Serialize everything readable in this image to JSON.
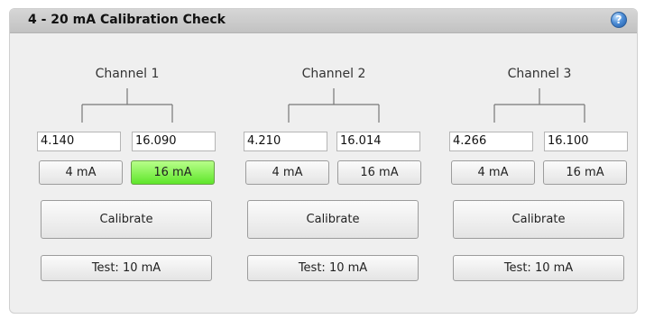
{
  "panel": {
    "title": "4 - 20 mA Calibration Check",
    "help_icon_glyph": "?"
  },
  "channels": [
    {
      "label": "Channel 1",
      "low_value": "4.140",
      "high_value": "16.090",
      "btn_4": "4 mA",
      "btn_16": "16 mA",
      "btn_16_active": true,
      "calibrate": "Calibrate",
      "test": "Test: 10 mA"
    },
    {
      "label": "Channel 2",
      "low_value": "4.210",
      "high_value": "16.014",
      "btn_4": "4 mA",
      "btn_16": "16 mA",
      "btn_16_active": false,
      "calibrate": "Calibrate",
      "test": "Test: 10 mA"
    },
    {
      "label": "Channel 3",
      "low_value": "4.266",
      "high_value": "16.100",
      "btn_4": "4 mA",
      "btn_16": "16 mA",
      "btn_16_active": false,
      "calibrate": "Calibrate",
      "test": "Test: 10 mA"
    }
  ],
  "colors": {
    "active_button": "#5ee62a",
    "title_bar": "#c8c8c8",
    "panel_bg": "#efefef"
  }
}
